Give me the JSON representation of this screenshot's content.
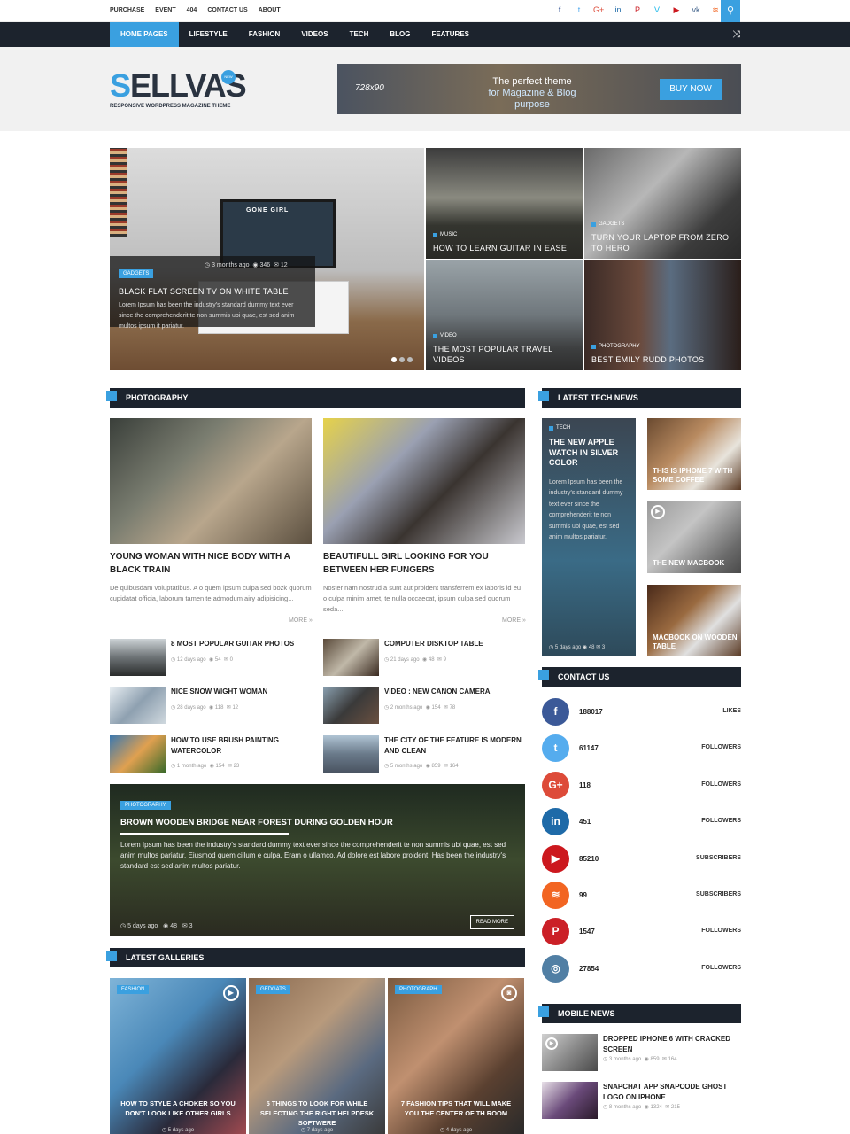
{
  "topbar": {
    "links": [
      "PURCHASE",
      "EVENT",
      "404",
      "CONTACT US",
      "ABOUT"
    ],
    "social_icons": [
      "facebook-icon",
      "twitter-icon",
      "google-plus-icon",
      "linkedin-icon",
      "pinterest-icon",
      "vimeo-icon",
      "youtube-icon",
      "vk-icon",
      "rss-icon"
    ],
    "search_icon": "search-icon"
  },
  "nav": {
    "items": [
      "HOME PAGES",
      "LIFESTYLE",
      "FASHION",
      "VIDEOS",
      "TECH",
      "BLOG",
      "FEATURES"
    ],
    "active": "HOME PAGES",
    "shuffle_icon": "shuffle-icon"
  },
  "header": {
    "logo_word": "ELLVAS",
    "logo_s": "S",
    "logo_tagline": "RESPONSIVE WORDPRESS MAGAZINE THEME",
    "logo_badge": "NEW",
    "banner_size": "728x90",
    "banner_line1": "The perfect theme",
    "banner_line2": "for Magazine & Blog purpose",
    "banner_button": "BUY NOW"
  },
  "hero": {
    "main": {
      "badge": "GADGETS",
      "time": "3 months ago",
      "views": "346",
      "comments": "12",
      "title": "BLACK FLAT SCREEN TV ON WHITE TABLE",
      "excerpt": "Lorem Ipsum has been the industry's standard dummy text ever since the comprehenderit te non summis ubi quae, est sed anim multos ipsum it pariatur.",
      "tv_text": "GONE GIRL"
    },
    "tiles": [
      {
        "cat": "MUSIC",
        "title": "HOW TO LEARN GUITAR IN EASE"
      },
      {
        "cat": "GADGETS",
        "title": "TURN YOUR LAPTOP FROM ZERO TO HERO"
      },
      {
        "cat": "VIDEO",
        "title": "THE MOST POPULAR TRAVEL VIDEOS"
      },
      {
        "cat": "PHOTOGRAPHY",
        "title": "BEST EMILY RUDD PHOTOS"
      }
    ]
  },
  "photography": {
    "title": "PHOTOGRAPHY",
    "posts": [
      {
        "title": "YOUNG WOMAN WITH NICE BODY WITH A BLACK TRAIN",
        "excerpt": "De quibusdam voluptatibus. A o quem ipsum culpa sed bozk quorum cupidatat officia, laborum tamen te admodum airy adipisicing...",
        "more": "MORE »"
      },
      {
        "title": "BEAUTIFULL GIRL LOOKING FOR YOU BETWEEN HER FUNGERS",
        "excerpt": "Noster nam nostrud a sunt aut proident transferrem ex laboris id eu o culpa minim amet, te nulla occaecat, ipsum culpa sed quorum seda...",
        "more": "MORE »"
      }
    ],
    "small_left": [
      {
        "title": "8 MOST POPULAR GUITAR PHOTOS",
        "time": "12 days ago",
        "views": "54",
        "comments": "0"
      },
      {
        "title": "NICE SNOW WIGHT WOMAN",
        "time": "28 days ago",
        "views": "118",
        "comments": "12"
      },
      {
        "title": "HOW TO USE BRUSH PAINTING WATERCOLOR",
        "time": "1 month ago",
        "views": "154",
        "comments": "23"
      }
    ],
    "small_right": [
      {
        "title": "COMPUTER DISKTOP TABLE",
        "time": "21 days ago",
        "views": "48",
        "comments": "9"
      },
      {
        "title": "VIDEO : NEW CANON CAMERA",
        "time": "2 months ago",
        "views": "154",
        "comments": "78"
      },
      {
        "title": "THE CITY OF THE FEATURE IS MODERN AND CLEAN",
        "time": "5 months ago",
        "views": "859",
        "comments": "164"
      }
    ]
  },
  "feature": {
    "badge": "PHOTOGRAPHY",
    "title": "BROWN WOODEN BRIDGE NEAR FOREST DURING GOLDEN HOUR",
    "excerpt": "Lorem Ipsum has been the industry's standard dummy text ever since the comprehenderit te non summis ubi quae, est sed anim multos pariatur. Eiusmod quem cillum e culpa. Eram o ullamco. Ad dolore est labore proident. Has been the industry's standard est sed anim multos pariatur.",
    "time": "5 days ago",
    "views": "48",
    "comments": "3",
    "read_more": "READ MORE"
  },
  "galleries": {
    "title": "LATEST GALLERIES",
    "items": [
      {
        "badge": "FASHION",
        "title": "HOW TO STYLE A CHOKER SO YOU DON'T LOOK LIKE OTHER GIRLS",
        "time": "5 days ago",
        "icon": "play-icon"
      },
      {
        "badge": "GEDGATS",
        "title": "5 THINGS TO LOOK FOR WHILE SELECTING THE RIGHT HELPDESK SOFTWERE",
        "time": "7 days ago",
        "icon": "none"
      },
      {
        "badge": "PHOTOGRAPH",
        "title": "7 FASHION TIPS THAT WILL MAKE YOU THE CENTER OF TH ROOM",
        "time": "4 days ago",
        "icon": "camera-icon"
      }
    ]
  },
  "tech_news": {
    "title": "LATEST TECH NEWS",
    "big": {
      "cat": "TECH",
      "title": "THE NEW APPLE WATCH IN SILVER COLOR",
      "excerpt": "Lorem Ipsum has been the industry's standard dummy text ever since the comprehenderit te non summis ubi quae, est sed anim multos pariatur.",
      "time": "5 days ago",
      "views": "48",
      "comments": "3"
    },
    "small": [
      {
        "title": "THIS IS IPHONE 7 WITH SOME COFFEE"
      },
      {
        "title": "THE NEW MACBOOK"
      },
      {
        "title": "MACBOOK ON WOODEN TABLE"
      }
    ]
  },
  "contact": {
    "title": "CONTACT US",
    "rows": [
      {
        "icon": "facebook-icon",
        "glyph": "f",
        "count": "188017",
        "label": "LIKES",
        "color": "#3b5998"
      },
      {
        "icon": "twitter-icon",
        "glyph": "t",
        "count": "61147",
        "label": "FOLLOWERS",
        "color": "#55acee"
      },
      {
        "icon": "google-plus-icon",
        "glyph": "G+",
        "count": "118",
        "label": "FOLLOWERS",
        "color": "#dd4b39"
      },
      {
        "icon": "linkedin-icon",
        "glyph": "in",
        "count": "451",
        "label": "FOLLOWERS",
        "color": "#1e6aa8"
      },
      {
        "icon": "youtube-icon",
        "glyph": "▶",
        "count": "85210",
        "label": "SUBSCRIBERS",
        "color": "#cc181e"
      },
      {
        "icon": "rss-icon",
        "glyph": "≋",
        "count": "99",
        "label": "SUBSCRIBERS",
        "color": "#f26522"
      },
      {
        "icon": "pinterest-icon",
        "glyph": "P",
        "count": "1547",
        "label": "FOLLOWERS",
        "color": "#cb2027"
      },
      {
        "icon": "instagram-icon",
        "glyph": "◎",
        "count": "27854",
        "label": "FOLLOWERS",
        "color": "#517fa4"
      }
    ]
  },
  "mobile": {
    "title": "MOBILE NEWS",
    "items": [
      {
        "title": "DROPPED IPHONE 6 WITH CRACKED SCREEN",
        "time": "3 months ago",
        "views": "859",
        "comments": "164"
      },
      {
        "title": "SNAPCHAT APP SNAPCODE GHOST LOGO ON IPHONE",
        "time": "8 months ago",
        "views": "1324",
        "comments": "215"
      }
    ]
  },
  "colors": {
    "accent": "#3aa0e0",
    "dark": "#1c232d"
  }
}
